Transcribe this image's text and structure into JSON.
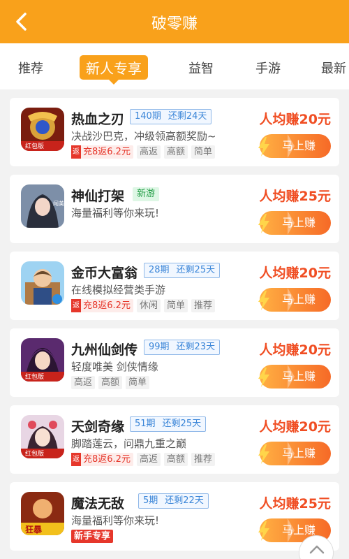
{
  "header": {
    "title": "破零赚",
    "back_icon": "chevron-left-icon"
  },
  "tabs": [
    {
      "label": "推荐",
      "active": false
    },
    {
      "label": "新人专享",
      "active": true
    },
    {
      "label": "益智",
      "active": false
    },
    {
      "label": "手游",
      "active": false
    },
    {
      "label": "最新",
      "active": false
    }
  ],
  "games": [
    {
      "name": "热血之刃",
      "period": "140期",
      "remaining": "还剩24天",
      "desc": "决战沙巴克，冲级领高额奖励~",
      "rebate": "充8返6.2元",
      "tags": [
        "高返",
        "高额",
        "简单"
      ],
      "earn": "人均赚20元",
      "button": "马上赚",
      "icon_badge": "红包版"
    },
    {
      "name": "神仙打架",
      "new_tag": "新游",
      "desc": "海量福利等你来玩!",
      "earn": "人均赚25元",
      "button": "马上赚",
      "icon_badge": "闯美"
    },
    {
      "name": "金币大富翁",
      "period": "28期",
      "remaining": "还剩25天",
      "desc": "在线模拟经营类手游",
      "rebate": "充8返6.2元",
      "tags": [
        "休闲",
        "简单",
        "推荐"
      ],
      "earn": "人均赚20元",
      "button": "马上赚"
    },
    {
      "name": "九州仙剑传",
      "period": "99期",
      "remaining": "还剩23天",
      "desc": "轻度唯美 剑侠情缘",
      "tags": [
        "高返",
        "高额",
        "简单"
      ],
      "earn": "人均赚20元",
      "button": "马上赚",
      "icon_badge": "红包版"
    },
    {
      "name": "天剑奇缘",
      "period": "51期",
      "remaining": "还剩25天",
      "desc": "脚踏莲云，问鼎九重之巅",
      "rebate": "充8返6.2元",
      "tags": [
        "高返",
        "高额",
        "推荐"
      ],
      "earn": "人均赚20元",
      "button": "马上赚",
      "icon_badge": "红包版"
    },
    {
      "name": "魔法无敌",
      "period": "5期",
      "remaining": "还剩22天",
      "desc": "海量福利等你来玩!",
      "novice_tag": "新手专享",
      "earn": "人均赚25元",
      "button": "马上赚",
      "icon_badge": "狂暴"
    }
  ],
  "rebate_mark": "返",
  "colors": {
    "accent": "#f9a11b",
    "earn": "#f04e23",
    "period": "#3b86d8"
  },
  "scroll_top_icon": "chevron-up-icon"
}
